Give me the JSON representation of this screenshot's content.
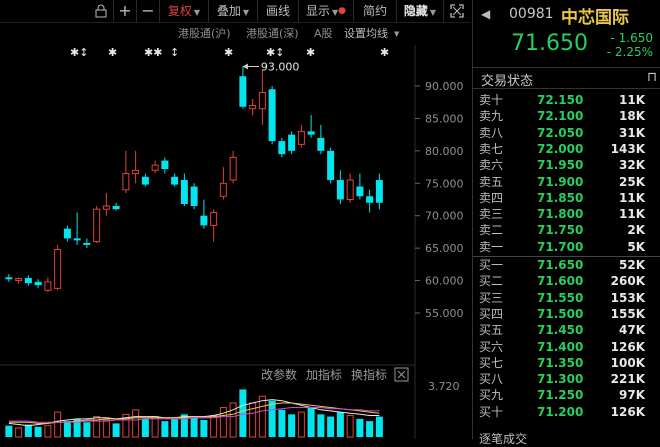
{
  "toolbar": {
    "icon_lock": "lock-icon",
    "icon_plus": "plus-icon",
    "icon_minus": "minus-icon",
    "fuquan": "复权",
    "diejia": "叠加",
    "huaxian": "画线",
    "xianshi": "显示",
    "jiandan": "简约",
    "yincang": "隐藏",
    "icon_expand": "expand-icon"
  },
  "legend": {
    "hk_sh": "港股通(沪)",
    "hk_sz": "港股通(深)",
    "a_share": "A股",
    "ma_setting": "设置均线"
  },
  "sub": {
    "param": "改参数",
    "add": "加指标",
    "switch": "换指标",
    "axis_label": "3.720"
  },
  "colors": {
    "up": "#e0433a",
    "down": "#00e5ee",
    "green": "#23d160",
    "yellow": "#e8c84a"
  },
  "quote": {
    "code": "00981",
    "name": "中芯国际",
    "price": "71.650",
    "change": "- 1.650",
    "change_pct": "- 2.25%",
    "section": "交易状态",
    "sell": [
      {
        "label": "卖十",
        "price": "72.150",
        "qty": "11K"
      },
      {
        "label": "卖九",
        "price": "72.100",
        "qty": "18K"
      },
      {
        "label": "卖八",
        "price": "72.050",
        "qty": "31K"
      },
      {
        "label": "卖七",
        "price": "72.000",
        "qty": "143K"
      },
      {
        "label": "卖六",
        "price": "71.950",
        "qty": "32K"
      },
      {
        "label": "卖五",
        "price": "71.900",
        "qty": "25K"
      },
      {
        "label": "卖四",
        "price": "71.850",
        "qty": "11K"
      },
      {
        "label": "卖三",
        "price": "71.800",
        "qty": "11K"
      },
      {
        "label": "卖二",
        "price": "71.750",
        "qty": "2K"
      },
      {
        "label": "卖一",
        "price": "71.700",
        "qty": "5K"
      }
    ],
    "buy": [
      {
        "label": "买一",
        "price": "71.650",
        "qty": "52K"
      },
      {
        "label": "买二",
        "price": "71.600",
        "qty": "260K"
      },
      {
        "label": "买三",
        "price": "71.550",
        "qty": "153K"
      },
      {
        "label": "买四",
        "price": "71.500",
        "qty": "155K"
      },
      {
        "label": "买五",
        "price": "71.450",
        "qty": "47K"
      },
      {
        "label": "买六",
        "price": "71.400",
        "qty": "126K"
      },
      {
        "label": "买七",
        "price": "71.350",
        "qty": "100K"
      },
      {
        "label": "买八",
        "price": "71.300",
        "qty": "221K"
      },
      {
        "label": "买九",
        "price": "71.250",
        "qty": "97K"
      },
      {
        "label": "买十",
        "price": "71.200",
        "qty": "126K"
      }
    ],
    "bottom_cut": "逐笔成交"
  },
  "chart_data": {
    "type": "candlestick",
    "y_ticks": [
      "90.000",
      "85.000",
      "80.000",
      "75.000",
      "70.000",
      "65.000",
      "60.000",
      "55.000"
    ],
    "ylim": [
      50,
      95
    ],
    "annotation": "93.000",
    "marker_labels": [
      "✱↕",
      "✱",
      "✱✱",
      "↕",
      "✱",
      "✱↕",
      "✱",
      "✱"
    ],
    "candles": [
      {
        "o": 60.5,
        "h": 61.0,
        "l": 59.8,
        "c": 60.2
      },
      {
        "o": 60.0,
        "h": 60.5,
        "l": 59.5,
        "c": 60.3
      },
      {
        "o": 60.4,
        "h": 60.8,
        "l": 59.2,
        "c": 59.6
      },
      {
        "o": 59.8,
        "h": 60.2,
        "l": 58.8,
        "c": 59.3
      },
      {
        "o": 58.5,
        "h": 60.5,
        "l": 58.2,
        "c": 59.8
      },
      {
        "o": 58.8,
        "h": 65.5,
        "l": 58.5,
        "c": 64.8
      },
      {
        "o": 68.0,
        "h": 68.5,
        "l": 66.0,
        "c": 66.5
      },
      {
        "o": 66.5,
        "h": 70.5,
        "l": 65.5,
        "c": 66.2
      },
      {
        "o": 65.8,
        "h": 66.5,
        "l": 65.0,
        "c": 65.5
      },
      {
        "o": 66.0,
        "h": 71.5,
        "l": 65.8,
        "c": 71.0
      },
      {
        "o": 71.0,
        "h": 73.5,
        "l": 70.0,
        "c": 71.5
      },
      {
        "o": 71.5,
        "h": 72.0,
        "l": 70.8,
        "c": 71.0
      },
      {
        "o": 74.0,
        "h": 80.0,
        "l": 73.5,
        "c": 76.5
      },
      {
        "o": 76.5,
        "h": 80.0,
        "l": 75.0,
        "c": 77.0
      },
      {
        "o": 76.0,
        "h": 76.5,
        "l": 74.5,
        "c": 74.8
      },
      {
        "o": 77.0,
        "h": 78.5,
        "l": 76.5,
        "c": 77.8
      },
      {
        "o": 78.5,
        "h": 79.0,
        "l": 76.5,
        "c": 77.2
      },
      {
        "o": 76.0,
        "h": 76.5,
        "l": 74.5,
        "c": 74.8
      },
      {
        "o": 75.5,
        "h": 76.5,
        "l": 71.5,
        "c": 71.8
      },
      {
        "o": 74.5,
        "h": 75.0,
        "l": 71.0,
        "c": 71.5
      },
      {
        "o": 70.0,
        "h": 72.5,
        "l": 68.0,
        "c": 68.5
      },
      {
        "o": 68.5,
        "h": 71.0,
        "l": 66.0,
        "c": 70.5
      },
      {
        "o": 73.0,
        "h": 77.5,
        "l": 72.5,
        "c": 75.0
      },
      {
        "o": 75.5,
        "h": 80.0,
        "l": 75.0,
        "c": 79.0
      },
      {
        "o": 91.5,
        "h": 93.0,
        "l": 86.5,
        "c": 86.8
      },
      {
        "o": 86.5,
        "h": 88.0,
        "l": 85.5,
        "c": 87.0
      },
      {
        "o": 86.5,
        "h": 92.5,
        "l": 84.0,
        "c": 89.0
      },
      {
        "o": 89.5,
        "h": 90.0,
        "l": 81.0,
        "c": 81.5
      },
      {
        "o": 81.5,
        "h": 82.0,
        "l": 79.0,
        "c": 79.5
      },
      {
        "o": 82.5,
        "h": 83.0,
        "l": 79.5,
        "c": 80.0
      },
      {
        "o": 81.0,
        "h": 84.0,
        "l": 80.5,
        "c": 83.0
      },
      {
        "o": 83.0,
        "h": 85.5,
        "l": 82.0,
        "c": 82.5
      },
      {
        "o": 82.0,
        "h": 84.0,
        "l": 79.5,
        "c": 80.0
      },
      {
        "o": 80.0,
        "h": 80.5,
        "l": 75.0,
        "c": 75.5
      },
      {
        "o": 75.5,
        "h": 77.0,
        "l": 71.8,
        "c": 72.5
      },
      {
        "o": 72.5,
        "h": 76.5,
        "l": 72.0,
        "c": 75.5
      },
      {
        "o": 74.5,
        "h": 76.5,
        "l": 72.5,
        "c": 73.0
      },
      {
        "o": 73.0,
        "h": 74.0,
        "l": 70.5,
        "c": 72.0
      },
      {
        "o": 75.5,
        "h": 76.5,
        "l": 71.0,
        "c": 72.0
      }
    ],
    "volume": [
      1.0,
      0.8,
      1.1,
      0.9,
      1.0,
      2.2,
      1.4,
      1.6,
      1.3,
      1.8,
      1.5,
      1.2,
      2.0,
      2.4,
      1.6,
      1.8,
      1.4,
      1.6,
      2.0,
      1.7,
      1.5,
      1.9,
      2.6,
      3.0,
      4.2,
      3.0,
      3.6,
      3.2,
      2.4,
      2.0,
      2.2,
      2.6,
      2.0,
      1.8,
      2.2,
      1.9,
      1.6,
      1.4,
      1.8
    ],
    "vol_ylim": [
      0,
      4.5
    ],
    "ma_lines": [
      {
        "color": "#e8e8e8",
        "values": [
          1.2,
          1.1,
          1.0,
          1.1,
          1.2,
          1.4,
          1.5,
          1.6,
          1.6,
          1.7,
          1.7,
          1.6,
          1.7,
          1.8,
          1.8,
          1.8,
          1.7,
          1.7,
          1.8,
          1.8,
          1.8,
          1.9,
          2.1,
          2.4,
          2.8,
          3.0,
          3.2,
          3.3,
          3.2,
          3.0,
          2.8,
          2.6,
          2.4,
          2.3,
          2.2,
          2.1,
          2.0,
          1.9,
          1.9
        ]
      },
      {
        "color": "#e8c84a",
        "values": [
          1.3,
          1.3,
          1.3,
          1.2,
          1.2,
          1.3,
          1.3,
          1.4,
          1.5,
          1.5,
          1.6,
          1.6,
          1.6,
          1.7,
          1.7,
          1.7,
          1.7,
          1.7,
          1.7,
          1.7,
          1.7,
          1.8,
          1.9,
          2.0,
          2.3,
          2.5,
          2.7,
          2.9,
          3.0,
          3.0,
          2.9,
          2.8,
          2.7,
          2.6,
          2.5,
          2.4,
          2.3,
          2.2,
          2.1
        ]
      },
      {
        "color": "#d04ad0",
        "values": [
          1.4,
          1.4,
          1.4,
          1.3,
          1.3,
          1.3,
          1.3,
          1.3,
          1.4,
          1.4,
          1.4,
          1.5,
          1.5,
          1.5,
          1.6,
          1.6,
          1.6,
          1.6,
          1.6,
          1.7,
          1.7,
          1.7,
          1.8,
          1.8,
          2.0,
          2.1,
          2.3,
          2.4,
          2.5,
          2.6,
          2.6,
          2.6,
          2.6,
          2.5,
          2.5,
          2.4,
          2.4,
          2.3,
          2.3
        ]
      }
    ]
  }
}
